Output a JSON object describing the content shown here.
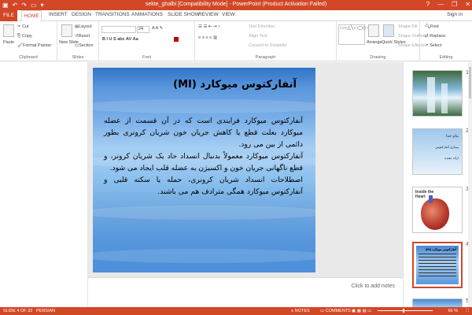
{
  "titlebar": {
    "title": "sekte_ghalbi [Compatibility Mode] - PowerPoint (Product Activation Failed)",
    "qat": [
      "save-icon",
      "undo-icon",
      "redo-icon",
      "start-icon",
      "customize-icon"
    ],
    "controls": [
      "?",
      "—",
      "❐",
      "✕"
    ]
  },
  "tabs": {
    "file": "FILE",
    "items": [
      "HOME",
      "INSERT",
      "DESIGN",
      "TRANSITIONS",
      "ANIMATIONS",
      "SLIDE SHOW",
      "REVIEW",
      "VIEW"
    ],
    "signin": "Sign in"
  },
  "ribbon": {
    "clipboard": {
      "label": "Clipboard",
      "paste": "Paste",
      "cut": "Cut",
      "copy": "Copy",
      "format_painter": "Format Painter"
    },
    "slides": {
      "label": "Slides",
      "new_slide": "New Slide",
      "layout": "Layout",
      "reset": "Reset",
      "section": "Section"
    },
    "font": {
      "label": "Font",
      "font_name": "",
      "font_size": "24"
    },
    "paragraph": {
      "label": "Paragraph",
      "text_direction": "Text Direction",
      "align_text": "Align Text",
      "convert": "Convert to SmartArt"
    },
    "drawing": {
      "label": "Drawing",
      "arrange": "Arrange",
      "quick_styles": "Quick Styles",
      "shape_fill": "Shape Fill",
      "shape_outline": "Shape Outline",
      "shape_effects": "Shape Effects"
    },
    "editing": {
      "label": "Editing",
      "find": "Find",
      "replace": "Replace",
      "select": "Select"
    }
  },
  "slide": {
    "title": "آنفارکتوس میوکارد (MI)",
    "paragraphs": [
      "آنفارکتوس میوکارد فرایندی است که در آن قسمت از عضله میوکارد بعلت قطع یا کاهش جریان خون شریان کرونری بطور دائمی از بین می رود.",
      "آنفارکتوس میوکارد معمولاً بدنبال انسداد حاد یک شریان کرونر، و قطع ناگهانی جریان خون و اکسیژن به عضله قلب ایجاد می شود.",
      "اصطلاحات انسداد شریان کرونری، حمله یا سکته قلبی و آنفارکتوس میوکارد همگی مترادف هم می باشند."
    ]
  },
  "notes": {
    "placeholder": "Click to add notes"
  },
  "thumbnails": [
    {
      "num": "1",
      "kind": "waterfall"
    },
    {
      "num": "2",
      "kind": "text",
      "title": "بنام خدا",
      "line1": "بیماری آنفارکتوس",
      "line2": "ارائه دهنده"
    },
    {
      "num": "3",
      "kind": "heart",
      "title": "Inside the Heart"
    },
    {
      "num": "4",
      "kind": "current",
      "title": "آنفارکتوس میوکارد (MI)"
    },
    {
      "num": "5",
      "kind": "partial"
    }
  ],
  "status": {
    "slide": "SLIDE 4 OF 32",
    "language": "PERSIAN",
    "notes": "NOTES",
    "comments": "COMMENTS",
    "zoom": "66 %",
    "zoom_level_percent": 66
  },
  "colors": {
    "accent": "#d24726",
    "slide_blue": "#5b97dc"
  }
}
